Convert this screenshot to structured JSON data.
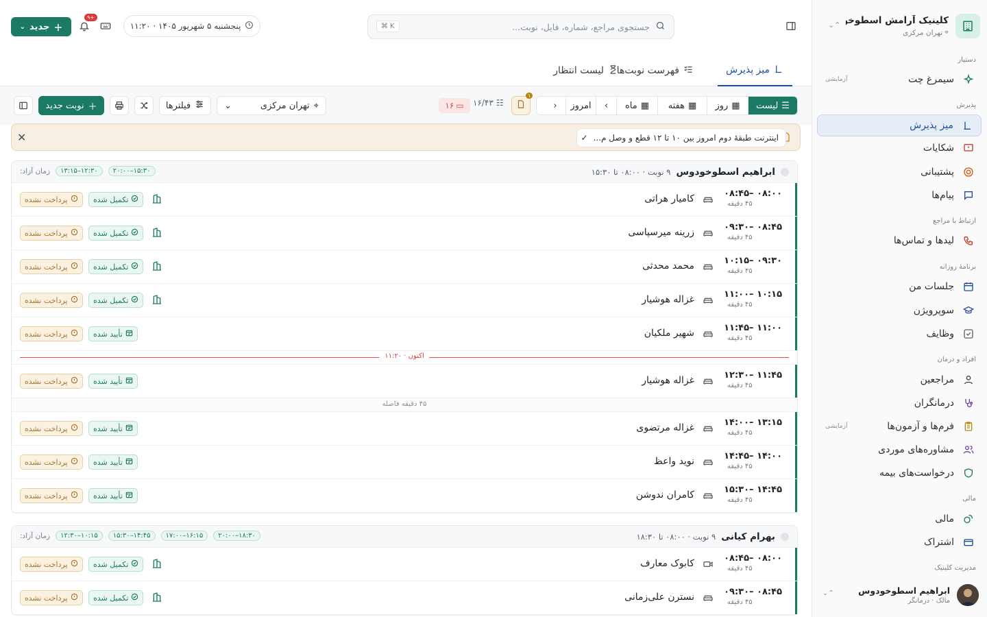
{
  "clinic": {
    "name": "کلینیک آرامش اسطوخو...",
    "location": "تهران مرکزی"
  },
  "sidebar": {
    "sections": [
      {
        "label": "دستیار"
      },
      {
        "label": "پذیرش"
      },
      {
        "label": "ارتباط با مراجع"
      },
      {
        "label": "برنامهٔ روزانه"
      },
      {
        "label": "افراد و درمان"
      },
      {
        "label": "مالی"
      },
      {
        "label": "مدیریت کلینیک"
      }
    ],
    "items": [
      {
        "label": "سیمرغ چت",
        "badge": "آزمایشی"
      },
      {
        "label": "میز پذیرش"
      },
      {
        "label": "شکایات"
      },
      {
        "label": "پشتیبانی"
      },
      {
        "label": "پیام‌ها"
      },
      {
        "label": "لیدها و تماس‌ها"
      },
      {
        "label": "جلسات من"
      },
      {
        "label": "سوپرویژن"
      },
      {
        "label": "وظایف"
      },
      {
        "label": "مراجعین"
      },
      {
        "label": "درمانگران"
      },
      {
        "label": "فرم‌ها و آزمون‌ها",
        "badge": "آزمایشی"
      },
      {
        "label": "مشاوره‌های موردی"
      },
      {
        "label": "درخواست‌های بیمه"
      },
      {
        "label": "مالی"
      },
      {
        "label": "اشتراک"
      }
    ],
    "user": {
      "name": "ابراهیم اسطوخودوس",
      "role": "مالک · درمانگر"
    }
  },
  "topbar": {
    "search_placeholder": "جستجوی مراجع، شماره، فایل، نوبت...",
    "search_kbd": "⌘ K",
    "date": "پنجشنبه ۵ شهریور ۱۴۰۵ · ۱۱:۲۰",
    "notif_count": "۹+",
    "new_label": "جدید"
  },
  "tabs": [
    {
      "label": "میز پذیرش",
      "active": true
    },
    {
      "label": "فهرست نوبت‌ها"
    },
    {
      "label": "لیست انتظار"
    }
  ],
  "toolbar": {
    "views": [
      "لیست",
      "روز",
      "هفته",
      "ماه"
    ],
    "today": "امروز",
    "counter": "۱۶/۴۳",
    "unpaid": "۱۶",
    "doc_badge": "۱",
    "location": "تهران مرکزی",
    "filters": "فیلترها",
    "new_appt": "نوبت جدید"
  },
  "alert": {
    "text": "اینترنت طبقهٔ دوم امروز بین ۱۰ تا ۱۲ قطع و وصل م..."
  },
  "groups": [
    {
      "therapist": "ابراهیم اسطوخودوس",
      "meta": "۹ نوبت · ۰۸:۰۰ تا ۱۵:۳۰",
      "free_label": "زمان آزاد:",
      "free_slots": [
        "۱۲:۳۰–۱۳:۱۵",
        "۱۵:۳۰–۲۰:۰۰"
      ],
      "rows": [
        {
          "time": "۰۸:۰۰ –۰۸:۴۵",
          "dur": "۴۵ دقیقه",
          "name": "کامیار هراتی",
          "status": "تکمیل شده",
          "pay": "پرداخت نشده",
          "bld": true
        },
        {
          "time": "۰۸:۴۵ –۰۹:۳۰",
          "dur": "۴۵ دقیقه",
          "name": "زرینه میرسپاسی",
          "status": "تکمیل شده",
          "pay": "پرداخت نشده",
          "bld": true
        },
        {
          "time": "۰۹:۳۰ –۱۰:۱۵",
          "dur": "۴۵ دقیقه",
          "name": "محمد محدثی",
          "status": "تکمیل شده",
          "pay": "پرداخت نشده",
          "bld": true
        },
        {
          "time": "۱۰:۱۵ –۱۱:۰۰",
          "dur": "۴۵ دقیقه",
          "name": "غزاله هوشیار",
          "status": "تکمیل شده",
          "pay": "پرداخت نشده",
          "bld": true
        },
        {
          "time": "۱۱:۰۰ –۱۱:۴۵",
          "dur": "۴۵ دقیقه",
          "name": "شهیر ملکیان",
          "status": "تأیید شده",
          "pay": "پرداخت نشده",
          "bld": false
        },
        {
          "now": "اکنون · ۱۱:۲۰"
        },
        {
          "time": "۱۱:۴۵ –۱۲:۳۰",
          "dur": "۴۵ دقیقه",
          "name": "غزاله هوشیار",
          "status": "تأیید شده",
          "pay": "پرداخت نشده",
          "bld": false
        },
        {
          "gap": "۴۵ دقیقه فاصله"
        },
        {
          "time": "۱۳:۱۵ –۱۴:۰۰",
          "dur": "۴۵ دقیقه",
          "name": "غزاله مرتضوی",
          "status": "تأیید شده",
          "pay": "پرداخت نشده",
          "bld": false
        },
        {
          "time": "۱۴:۰۰ –۱۴:۴۵",
          "dur": "۴۵ دقیقه",
          "name": "نوید واعظ",
          "status": "تأیید شده",
          "pay": "پرداخت نشده",
          "bld": false
        },
        {
          "time": "۱۴:۴۵ –۱۵:۳۰",
          "dur": "۴۵ دقیقه",
          "name": "کامران ندوشن",
          "status": "تأیید شده",
          "pay": "پرداخت نشده",
          "bld": false
        }
      ]
    },
    {
      "therapist": "بهرام کیانی",
      "meta": "۹ نوبت · ۰۸:۰۰ تا ۱۸:۳۰",
      "free_label": "زمان آزاد:",
      "free_slots": [
        "۱۰:۱۵–۱۲:۳۰",
        "۱۴:۴۵–۱۵:۳۰",
        "۱۶:۱۵–۱۷:۰۰",
        "۱۸:۳۰–۲۰:۰۰"
      ],
      "rows": [
        {
          "time": "۰۸:۰۰ –۰۸:۴۵",
          "dur": "۴۵ دقیقه",
          "name": "کابوک معارف",
          "status": "تکمیل شده",
          "pay": "پرداخت نشده",
          "bld": true,
          "video": true
        },
        {
          "time": "۰۸:۴۵ –۰۹:۳۰",
          "dur": "۴۵ دقیقه",
          "name": "نسترن علی‌زمانی",
          "status": "تکمیل شده",
          "pay": "پرداخت نشده",
          "bld": true
        }
      ]
    }
  ]
}
